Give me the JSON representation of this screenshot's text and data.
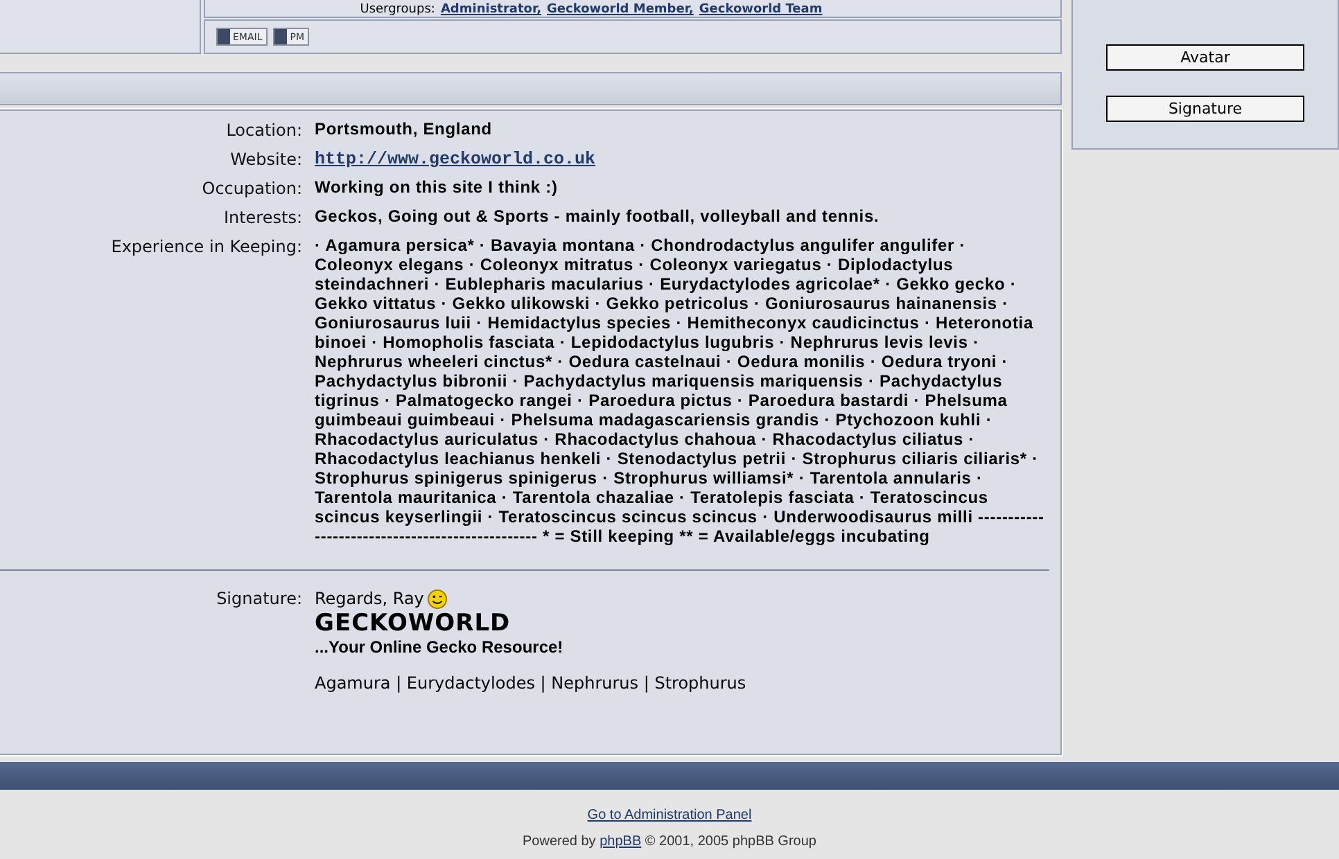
{
  "top_post": {
    "usergroups_label": "Usergroups:",
    "usergroups": [
      "Administrator,",
      "Geckoworld Member,",
      "Geckoworld Team"
    ],
    "buttons": [
      "EMAIL",
      "PM"
    ]
  },
  "side_buttons": [
    "Avatar",
    "Signature"
  ],
  "profile": [
    {
      "label": "Location:",
      "value": "Portsmouth, England",
      "kind": "text"
    },
    {
      "label": "Website:",
      "value": "http://www.geckoworld.co.uk",
      "kind": "link"
    },
    {
      "label": "Occupation:",
      "value": "Working on this site I think :)",
      "kind": "text"
    },
    {
      "label": "Interests:",
      "value": "Geckos, Going out & Sports - mainly football, volleyball and tennis.",
      "kind": "text"
    },
    {
      "label": "Experience in Keeping:",
      "value": "· Agamura persica* · Bavayia montana · Chondrodactylus angulifer angulifer · Coleonyx elegans · Coleonyx mitratus · Coleonyx variegatus · Diplodactylus steindachneri · Eublepharis macularius · Eurydactylodes agricolae* · Gekko gecko · Gekko vittatus · Gekko ulikowski · Gekko petricolus · Goniurosaurus hainanensis · Goniurosaurus luii · Hemidactylus species · Hemitheconyx caudicinctus · Heteronotia binoei · Homopholis fasciata · Lepidodactylus lugubris · Nephrurus levis levis · Nephrurus wheeleri cinctus* · Oedura castelnaui · Oedura monilis · Oedura tryoni · Pachydactylus bibronii · Pachydactylus mariquensis mariquensis · Pachydactylus tigrinus · Palmatogecko rangei · Paroedura pictus · Paroedura bastardi · Phelsuma guimbeaui guimbeaui · Phelsuma madagascariensis grandis · Ptychozoon kuhli · Rhacodactylus auriculatus · Rhacodactylus chahoua · Rhacodactylus ciliatus · Rhacodactylus leachianus henkeli · Stenodactylus petrii · Strophurus ciliaris ciliaris* · Strophurus spinigerus spinigerus · Strophurus williamsi* · Tarentola annularis · Tarentola mauritanica · Tarentola chazaliae · Teratolepis fasciata · Teratoscincus scincus keyserlingii · Teratoscincus scincus scincus · Underwoodisaurus milli ------------------------------------------------ * = Still keeping ** = Available/eggs incubating",
      "kind": "text"
    }
  ],
  "signature": {
    "label": "Signature:",
    "greeting": "Regards, Ray",
    "title": "GECKOWORLD",
    "tagline": "...Your Online Gecko Resource!",
    "links": "Agamura | Eurydactylodes | Nephrurus | Strophurus"
  },
  "footer": {
    "admin_link": "Go to Administration Panel",
    "powered_prefix": "Powered by",
    "powered_link": "phpBB",
    "powered_suffix": "© 2001, 2005 phpBB Group"
  }
}
